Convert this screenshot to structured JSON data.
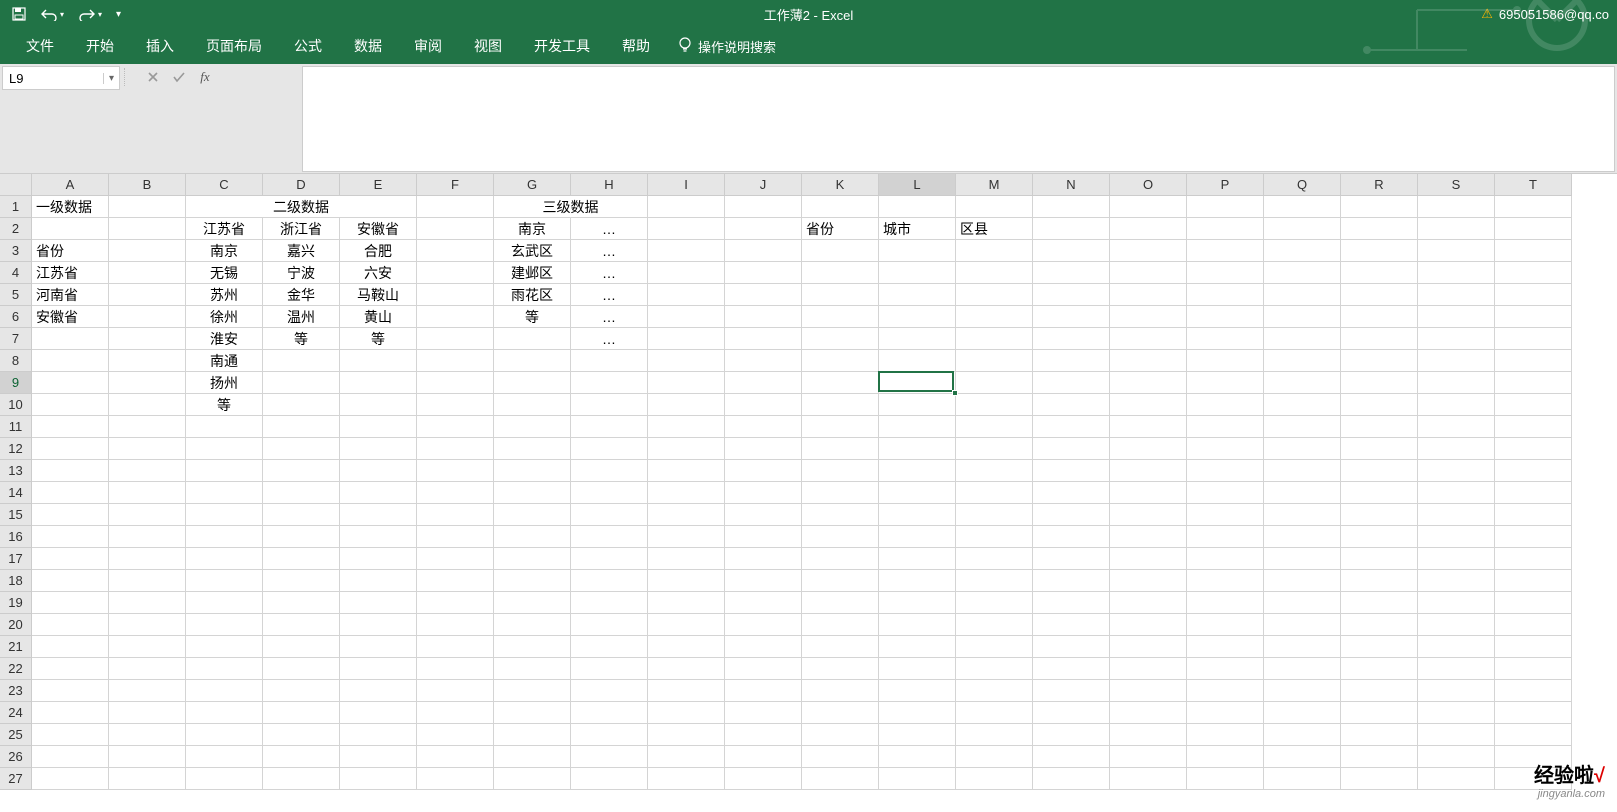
{
  "title": "工作薄2 - Excel",
  "account": "695051586@qq.co",
  "qat": {
    "save": "save-icon",
    "undo": "undo-icon",
    "redo": "redo-icon"
  },
  "tabs": [
    "文件",
    "开始",
    "插入",
    "页面布局",
    "公式",
    "数据",
    "审阅",
    "视图",
    "开发工具",
    "帮助"
  ],
  "tell_me": "操作说明搜索",
  "name_box": "L9",
  "formula": "",
  "columns": [
    "A",
    "B",
    "C",
    "D",
    "E",
    "F",
    "G",
    "H",
    "I",
    "J",
    "K",
    "L",
    "M",
    "N",
    "O",
    "P",
    "Q",
    "R",
    "S",
    "T"
  ],
  "row_count": 27,
  "active_cell": {
    "col": 11,
    "row": 8
  },
  "cells": {
    "r1": {
      "A": "一级数据",
      "C_merge": "二级数据",
      "G_merge": "三级数据"
    },
    "r2": {
      "C": "江苏省",
      "D": "浙江省",
      "E": "安徽省",
      "G": "南京",
      "H": "…",
      "K": "省份",
      "L": "城市",
      "M": "区县"
    },
    "r3": {
      "A": "省份",
      "C": "南京",
      "D": "嘉兴",
      "E": "合肥",
      "G": "玄武区",
      "H": "…"
    },
    "r4": {
      "A": "江苏省",
      "C": "无锡",
      "D": "宁波",
      "E": "六安",
      "G": "建邺区",
      "H": "…"
    },
    "r5": {
      "A": "河南省",
      "C": "苏州",
      "D": "金华",
      "E": "马鞍山",
      "G": "雨花区",
      "H": "…"
    },
    "r6": {
      "A": "安徽省",
      "C": "徐州",
      "D": "温州",
      "E": "黄山",
      "G": "等",
      "H": "…"
    },
    "r7": {
      "C": "淮安",
      "D": "等",
      "E": "等",
      "H": "…"
    },
    "r8": {
      "C": "南通"
    },
    "r9": {
      "C": "扬州"
    },
    "r10": {
      "C": "等"
    }
  },
  "watermark": {
    "main_black": "经验啦",
    "main_red": "√",
    "sub": "jingyanla.com"
  }
}
